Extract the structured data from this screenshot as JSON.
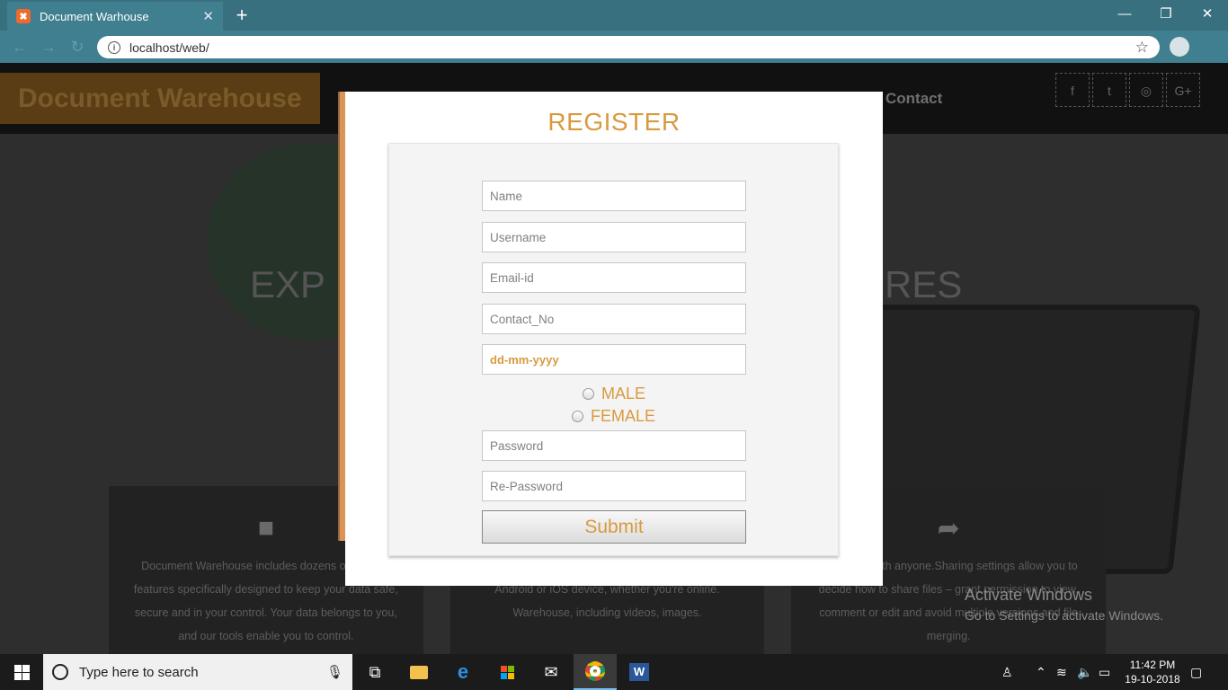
{
  "browser": {
    "tab_title": "Document Warhouse",
    "tab_close": "✕",
    "new_tab": "+",
    "url": "localhost/web/",
    "window_controls": [
      "—",
      "❐",
      "✕"
    ]
  },
  "site": {
    "brand": "Document Warehouse",
    "nav_contact": "Contact",
    "social": [
      "f",
      "t",
      "◎",
      "G+"
    ],
    "hero_left": "EXP",
    "hero_right": "RES",
    "features": [
      {
        "icon": "lock-icon",
        "glyph": "🔒",
        "text": "Document Warehouse includes dozens of security features specifically designed to keep your data safe, secure and in your control. Your data belongs to you, and our tools enable you to control."
      },
      {
        "icon": "device-icon",
        "glyph": "",
        "text": "computer, tablet or phone including your favorite Android or iOS device, whether you're online. Warehouse, including videos, images."
      },
      {
        "icon": "share-icon",
        "glyph": "➦",
        "text": "up to 5TB with anyone.Sharing settings allow you to decide how to share files – grant permission to view, comment or edit and avoid multiple versions and file merging."
      }
    ]
  },
  "modal": {
    "title": "REGISTER",
    "fields": {
      "name": "Name",
      "username": "Username",
      "email": "Email-id",
      "contact": "Contact_No",
      "dob": "dd-mm-yyyy",
      "password": "Password",
      "repassword": "Re-Password"
    },
    "gender_male": "MALE",
    "gender_female": "FEMALE",
    "submit": "Submit"
  },
  "windows_activation": {
    "line1": "Activate Windows",
    "line2": "Go to Settings to activate Windows."
  },
  "taskbar": {
    "search_placeholder": "Type here to search",
    "time": "11:42 PM",
    "date": "19-10-2018"
  },
  "colors": {
    "accent": "#d89a3e",
    "tabbar": "#39707f"
  }
}
